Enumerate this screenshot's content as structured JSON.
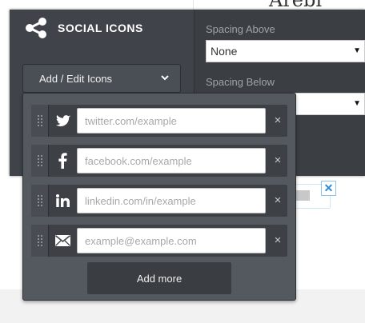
{
  "background": {
    "heading_fragment": "Arebi"
  },
  "panel": {
    "title": "SOCIAL ICONS",
    "add_edit_label": "Add / Edit Icons",
    "spacing_above": {
      "label": "Spacing Above",
      "value": "None"
    },
    "spacing_below": {
      "label": "Spacing Below",
      "value": ""
    }
  },
  "icons_editor": {
    "rows": [
      {
        "icon": "twitter-icon",
        "placeholder": "twitter.com/example",
        "value": ""
      },
      {
        "icon": "facebook-icon",
        "placeholder": "facebook.com/example",
        "value": ""
      },
      {
        "icon": "linkedin-icon",
        "placeholder": "linkedin.com/in/example",
        "value": ""
      },
      {
        "icon": "email-icon",
        "placeholder": "example@example.com",
        "value": ""
      }
    ],
    "remove_glyph": "×",
    "add_more_label": "Add more"
  },
  "colors": {
    "panel_bg": "#3b3e43",
    "dropdown_bg": "#54595f",
    "row_bg": "#3d4146",
    "accent_blue": "#2b8ad5"
  }
}
